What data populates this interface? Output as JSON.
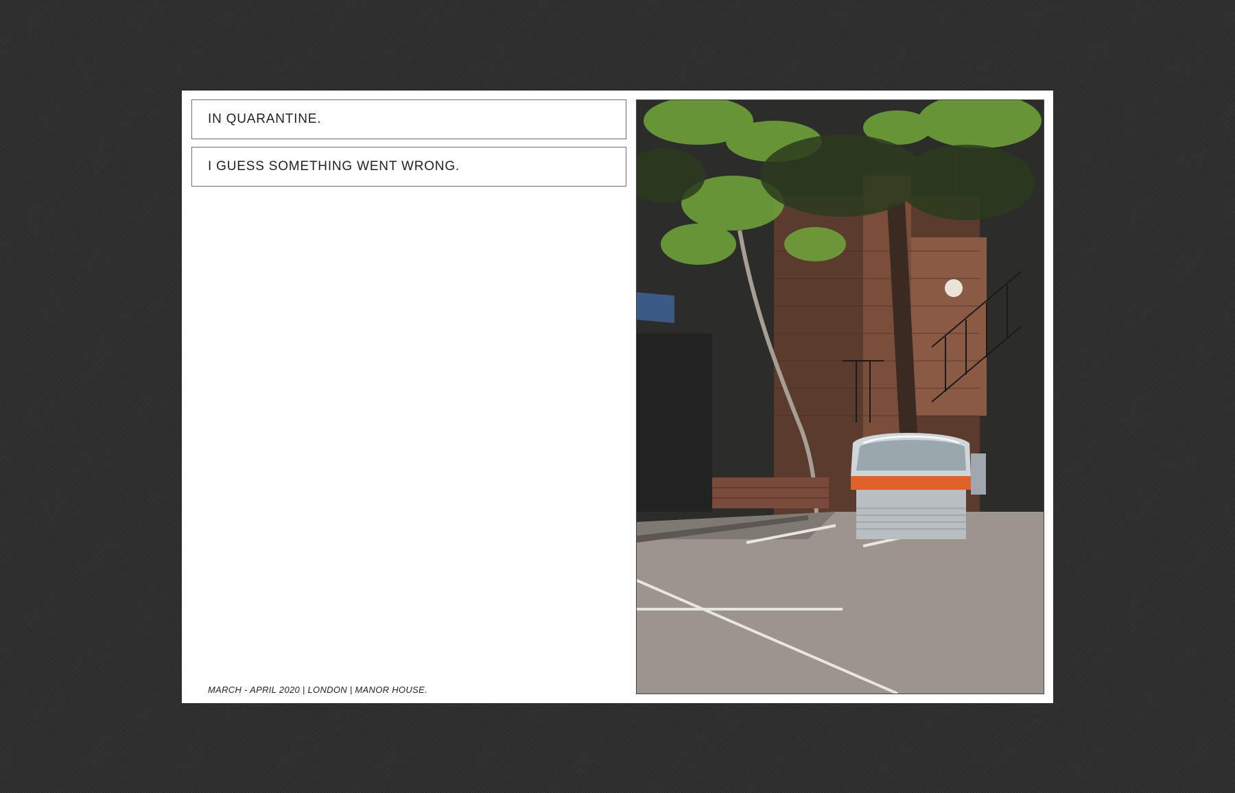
{
  "page": {
    "background_color": "#2f2f2f",
    "card_color": "#ffffff"
  },
  "headings": [
    {
      "text": "IN QUARANTINE."
    },
    {
      "text": "I GUESS SOMETHING WENT WRONG."
    }
  ],
  "caption": {
    "text": "MARCH - APRIL 2020 | LONDON | MANOR HOUSE."
  },
  "photo": {
    "subject": "display-fridge-under-tree",
    "colors": {
      "shadow": "#2c2c2b",
      "foliage": "#6fa03a",
      "brick": "#8a5a44",
      "pavement": "#9c958e",
      "fridge_stripe": "#e0622a"
    }
  }
}
